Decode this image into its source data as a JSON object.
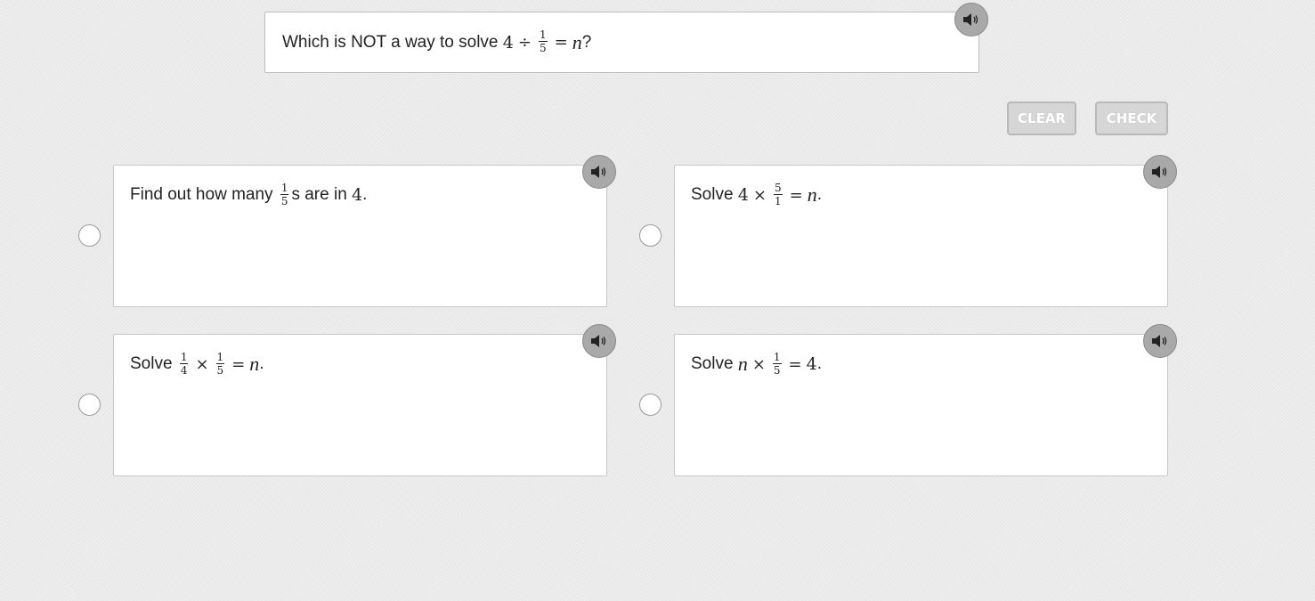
{
  "question": {
    "lead_text": "Which is NOT a way to solve",
    "expr": {
      "a": "4",
      "op1": "÷",
      "frac_num": "1",
      "frac_den": "5",
      "eq": "=",
      "var": "n",
      "end": "?"
    },
    "audio_icon": "speaker-icon"
  },
  "toolbar": {
    "clear_label": "CLEAR",
    "check_label": "CHECK"
  },
  "options": [
    {
      "pre": "Find out how many",
      "frac_num": "1",
      "frac_den": "5",
      "mid": "s are in",
      "num": "4",
      "end": "."
    },
    {
      "pre": "Solve",
      "a": "4",
      "op": "×",
      "frac_num": "5",
      "frac_den": "1",
      "eq": "=",
      "var": "n",
      "end": "."
    },
    {
      "pre": "Solve",
      "f1_num": "1",
      "f1_den": "4",
      "op": "×",
      "f2_num": "1",
      "f2_den": "5",
      "eq": "=",
      "var": "n",
      "end": "."
    },
    {
      "pre": "Solve",
      "var": "n",
      "op": "×",
      "frac_num": "1",
      "frac_den": "5",
      "eq": "=",
      "num": "4",
      "end": "."
    }
  ],
  "colors": {
    "accent_border": "#8fd0d6",
    "button_bg": "#d6d6d6",
    "audio_bg": "#a9a9a9"
  }
}
